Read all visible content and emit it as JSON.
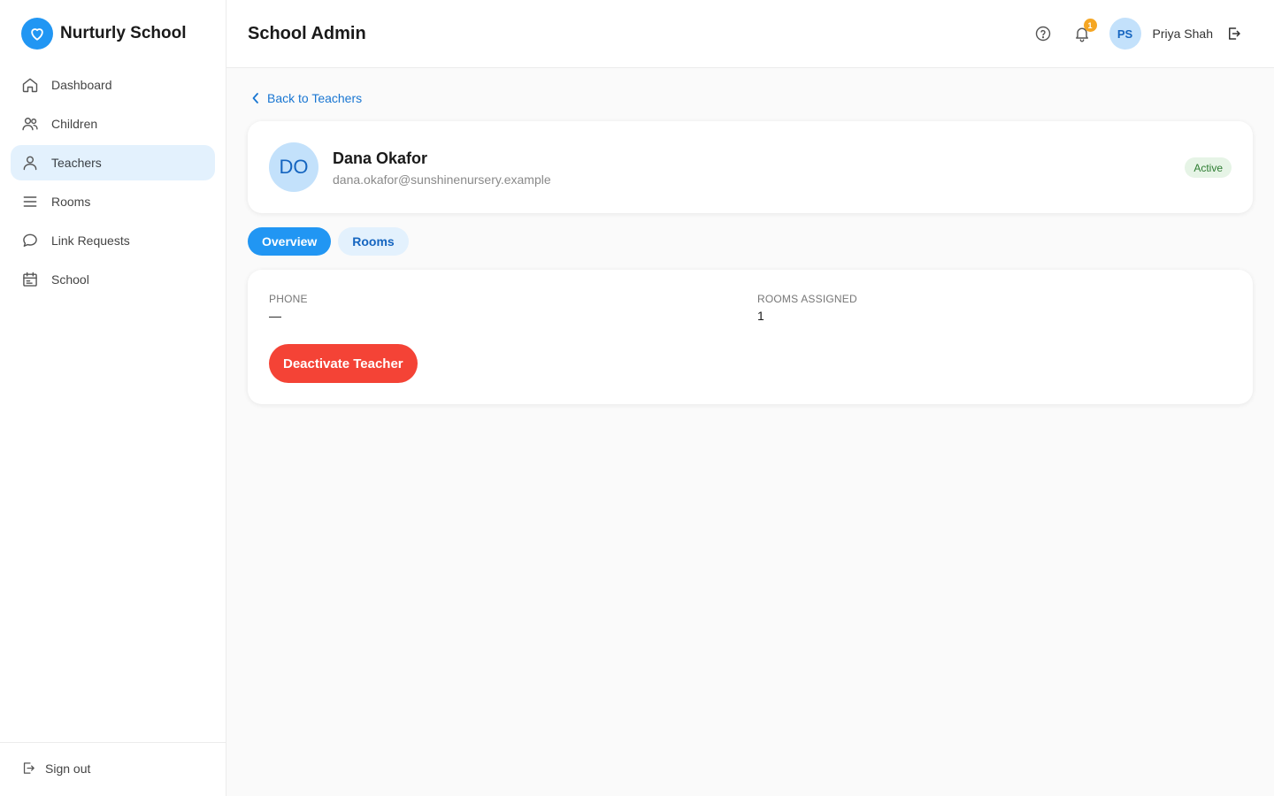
{
  "brand": {
    "name": "Nurturly School",
    "accent": "#2196f3"
  },
  "sidebar": {
    "items": [
      {
        "label": "Dashboard",
        "icon": "home-icon",
        "active": false
      },
      {
        "label": "Children",
        "icon": "users-icon",
        "active": false
      },
      {
        "label": "Teachers",
        "icon": "user-icon",
        "active": true
      },
      {
        "label": "Rooms",
        "icon": "menu-icon",
        "active": false
      },
      {
        "label": "Link Requests",
        "icon": "chat-bubble-icon",
        "active": false
      },
      {
        "label": "School",
        "icon": "calendar-icon",
        "active": false
      }
    ],
    "sign_out_label": "Sign out"
  },
  "header": {
    "title": "School Admin",
    "notification_count": "1",
    "user": {
      "initials": "PS",
      "name": "Priya Shah"
    }
  },
  "main": {
    "back_label": "Back to Teachers",
    "teacher": {
      "initials": "DO",
      "name": "Dana Okafor",
      "email": "dana.okafor@sunshinenursery.example",
      "status": "Active"
    },
    "tabs": [
      {
        "label": "Overview",
        "active": true
      },
      {
        "label": "Rooms",
        "active": false
      }
    ],
    "details": {
      "phone_label": "PHONE",
      "phone_value": "—",
      "rooms_label": "ROOMS ASSIGNED",
      "rooms_value": "1"
    },
    "deactivate_label": "Deactivate Teacher"
  },
  "colors": {
    "primary": "#2196f3",
    "active_nav_bg": "#e3f1fd",
    "danger": "#f44336",
    "badge": "#f5a623",
    "success": "#2e7d32"
  }
}
